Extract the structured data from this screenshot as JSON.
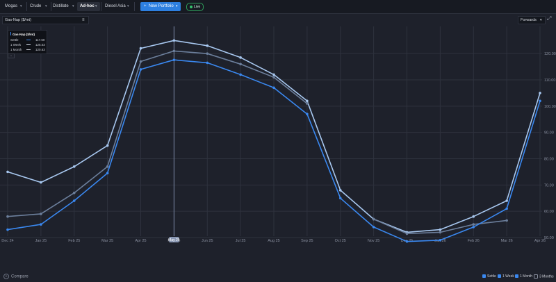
{
  "nav": {
    "tabs": [
      {
        "label": "Mogas",
        "active": false
      },
      {
        "label": "Crude",
        "active": false
      },
      {
        "label": "Distillate",
        "active": false
      },
      {
        "label": "Ad-hoc",
        "active": true
      },
      {
        "label": "Diesel Asia",
        "active": false
      }
    ],
    "new_portfolio": "New Portfolio",
    "live": "Live"
  },
  "toolbar": {
    "series_name": "Gas-Nap ($/mt)",
    "view_mode": "Forwards"
  },
  "legend": {
    "title": "Gas-Nap ($/mt)",
    "rows": [
      {
        "name": "Settle",
        "value": "117.60"
      },
      {
        "name": "1 Week",
        "value": "125.03"
      },
      {
        "name": "1 Month",
        "value": "120.63"
      }
    ]
  },
  "footer": {
    "compare": "Compare",
    "checkboxes": [
      {
        "label": "Settle",
        "checked": true
      },
      {
        "label": "1 Week",
        "checked": true
      },
      {
        "label": "1 Month",
        "checked": true
      },
      {
        "label": "3 Months",
        "checked": false
      }
    ]
  },
  "colors": {
    "settle": "#3a88f0",
    "week": "#a8c8f0",
    "month": "#6c7f9c",
    "background": "#1e212b",
    "grid": "#2e323e"
  },
  "chart_data": {
    "type": "line",
    "title": "",
    "xlabel": "",
    "ylabel": "",
    "ylim": [
      40,
      130
    ],
    "yticks": [
      "50.00",
      "60.00",
      "70.00",
      "80.00",
      "90.00",
      "100.00",
      "110.00",
      "120.00"
    ],
    "x": [
      "Dec 24",
      "Jan 25",
      "Feb 25",
      "Mar 25",
      "Apr 25",
      "May 25",
      "Jun 25",
      "Jul 25",
      "Aug 25",
      "Sep 25",
      "Oct 25",
      "Nov 25",
      "Dec 25",
      "Jan 26",
      "Feb 26",
      "Mar 26",
      "Apr 26"
    ],
    "crosshair": "May 25",
    "grid": true,
    "series": [
      {
        "name": "1 Week",
        "color": "#a8c8f0",
        "values": [
          75,
          71,
          77,
          85,
          122,
          125,
          123,
          118.5,
          112,
          102,
          68,
          57,
          52,
          53,
          58,
          64,
          105
        ]
      },
      {
        "name": "1 Month",
        "color": "#6c7f9c",
        "values": [
          58,
          59,
          67,
          77,
          117,
          121,
          120,
          116,
          111,
          101,
          null,
          57,
          51.5,
          52,
          55,
          56.5,
          null
        ]
      },
      {
        "name": "Settle",
        "color": "#3a88f0",
        "values": [
          53,
          55,
          64,
          74.5,
          114,
          117.6,
          116.5,
          112,
          107,
          97,
          65,
          54,
          48.5,
          49,
          54,
          61,
          102
        ]
      }
    ]
  }
}
